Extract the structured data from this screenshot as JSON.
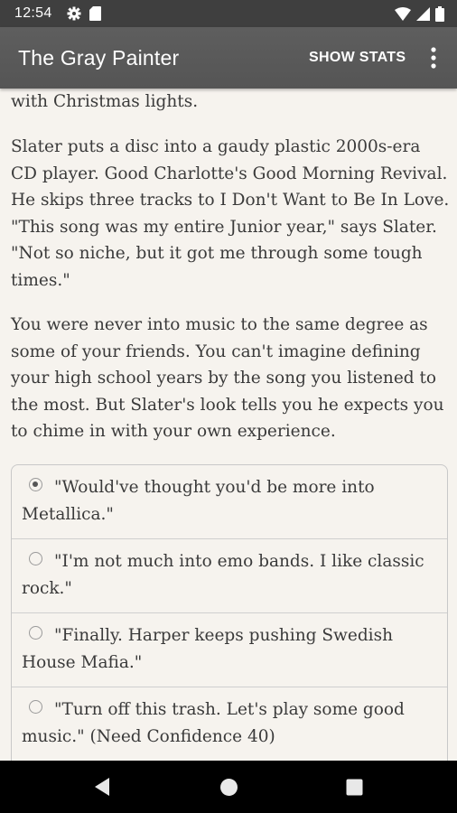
{
  "status_bar": {
    "time": "12:54",
    "icons": [
      "gear-icon",
      "sd-card-icon",
      "wifi-icon",
      "signal-icon",
      "battery-icon"
    ]
  },
  "app_bar": {
    "title": "The Gray Painter",
    "action_label": "SHOW STATS",
    "overflow_icon": "more-vert-icon"
  },
  "story": {
    "paragraphs": [
      "with Christmas lights.",
      "Slater puts a disc into a gaudy plastic 2000s-era CD player. Good Charlotte's Good Morning Revival. He skips three tracks to I Don't Want to Be In Love. \"This song was my entire Junior year,\" says Slater. \"Not so niche, but it got me through some tough times.\"",
      "You were never into music to the same degree as some of your friends. You can't imagine defining your high school years by the song you listened to the most. But Slater's look tells you he expects you to chime in with your own experience."
    ]
  },
  "choices": [
    {
      "label": "\"Would've thought you'd be more into Metallica.\"",
      "selected": true
    },
    {
      "label": "\"I'm not much into emo bands. I like classic rock.\"",
      "selected": false
    },
    {
      "label": "\"Finally. Harper keeps pushing Swedish House Mafia.\"",
      "selected": false
    },
    {
      "label": "\"Turn off this trash. Let's play some good music.\" (Need Confidence 40)",
      "selected": false
    }
  ],
  "nav_bar": {
    "icons": [
      "back-icon",
      "home-icon",
      "recents-icon"
    ]
  },
  "colors": {
    "background": "#f6f3ee",
    "app_bar": "#5a5a5a",
    "status_bar": "#3f3f3f",
    "text": "#3a3a3a"
  }
}
